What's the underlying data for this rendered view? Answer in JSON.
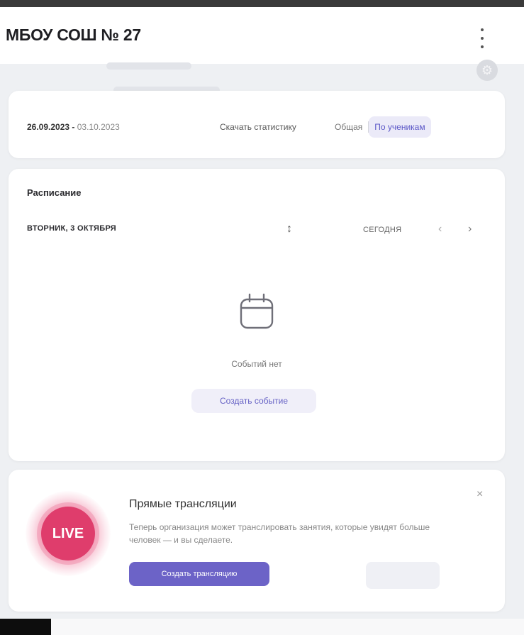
{
  "header": {
    "org_title": "МБОУ СОШ № 27",
    "menu_icon": "kebab-menu-icon",
    "settings_icon": "gear-icon"
  },
  "stats": {
    "date_range_start": "26.09.2023",
    "date_range_sep": " - ",
    "date_range_end": "03.10.2023",
    "download_label": "Скачать статистику",
    "segments": [
      {
        "label": "Общая",
        "active": false
      },
      {
        "label": "По ученикам",
        "active": true
      }
    ]
  },
  "schedule": {
    "title": "Расписание",
    "day_label": "ВТОРНИК, 3 ОКТЯБРЯ",
    "today_label": "СЕГОДНЯ",
    "prev_glyph": "‹",
    "next_glyph": "›",
    "sort_icon": "sort-arrows-icon",
    "empty_icon": "calendar-icon",
    "empty_text": "Событий нет",
    "create_label": "Создать событие"
  },
  "live": {
    "badge": "LIVE",
    "title": "Прямые трансляции",
    "description": "Теперь организация может транслировать занятия, которые увидят больше человек — и вы сделаете.",
    "cta_label": "Создать трансляцию",
    "close_glyph": "×"
  },
  "colors": {
    "accent": "#6c63c7",
    "live_red": "#df3d6c",
    "background": "#eef0f3"
  }
}
